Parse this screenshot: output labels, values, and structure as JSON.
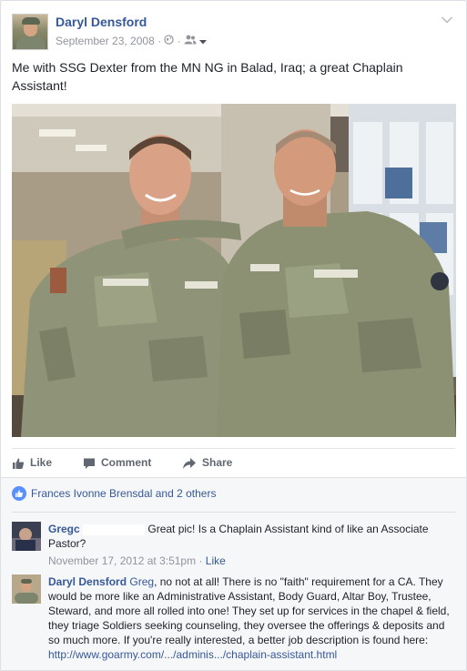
{
  "post": {
    "author": "Daryl Densford",
    "date": "September 23, 2008",
    "text": "Me with SSG Dexter from the MN NG in Balad, Iraq; a great Chaplain Assistant!",
    "icons": [
      "globe-icon",
      "friends-icon",
      "caret-down-icon",
      "chevron-down-icon"
    ]
  },
  "actions": {
    "like": "Like",
    "comment": "Comment",
    "share": "Share"
  },
  "likes_summary": "Frances Ivonne Brensdal and 2 others",
  "comments": [
    {
      "author": "Gregc",
      "text": "Great pic! Is a Chaplain Assistant kind of like an Associate Pastor?",
      "timestamp": "November 17, 2012 at 3:51pm",
      "like_label": "Like"
    },
    {
      "author": "Daryl Densford",
      "mention": "Greg",
      "text": ", no not at all! There is no \"faith\" requirement for a CA. They would be more like an Administrative Assistant, Body Guard, Altar Boy, Trustee, Steward, and more all rolled into one! They set up for services in the chapel & field, they triage Soldiers seeking counseling, they oversee the offerings & deposits and so much more. If you're really interested, a better job description is found here: ",
      "link": "http://www.goarmy.com/.../adminis.../chaplain-assistant.html"
    }
  ],
  "colors": {
    "link": "#365899",
    "meta": "#90949c",
    "like_badge": "#5890ff",
    "background": "#e9ebee"
  }
}
